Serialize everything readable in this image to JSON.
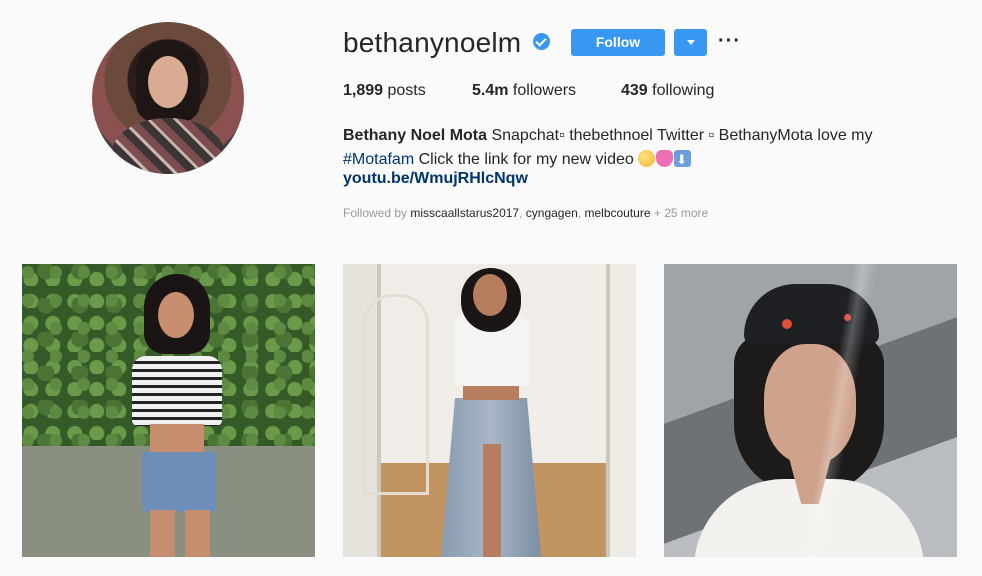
{
  "profile": {
    "username": "bethanynoelm",
    "follow_label": "Follow",
    "stats": {
      "posts_count": "1,899",
      "posts_label": "posts",
      "followers_count": "5.4m",
      "followers_label": "followers",
      "following_count": "439",
      "following_label": "following"
    },
    "bio": {
      "name": "Bethany Noel Mota",
      "line1": " Snapchat▫ thebethnoel Twitter ▫ BethanyMota love my",
      "hashtag": "#Motafam",
      "line2": " Click the link for my new video ",
      "link": "youtu.be/WmujRHlcNqw"
    },
    "followed_by": {
      "prefix": "Followed by ",
      "users": [
        "misscaallstarus2017",
        "cyngagen",
        "melbcouture"
      ],
      "suffix": " + 25 more"
    }
  },
  "icons": {
    "verified": "verified-badge-icon",
    "dropdown": "chevron-down-icon",
    "more": "more-options-icon"
  },
  "colors": {
    "accent": "#3897f0",
    "link": "#003569",
    "muted": "#999999",
    "background": "#fafafa"
  },
  "posts": [
    {
      "alt": "post-photo-1"
    },
    {
      "alt": "post-photo-2"
    },
    {
      "alt": "post-photo-3"
    }
  ]
}
